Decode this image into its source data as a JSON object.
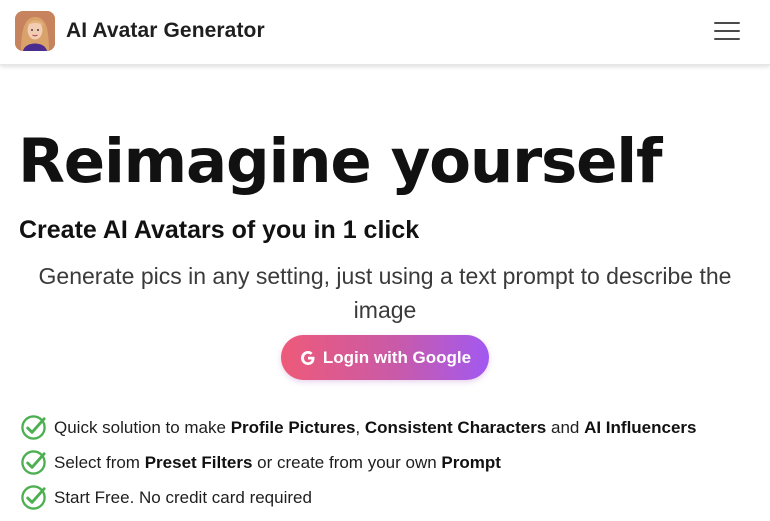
{
  "header": {
    "title": "AI Avatar Generator",
    "logo_icon": "avatar-photo-icon",
    "menu_icon": "hamburger-menu-icon"
  },
  "hero": {
    "title": "Reimagine yourself",
    "subtitle": "Create AI Avatars of you in 1 click",
    "description": "Generate pics in any setting, just using a text prompt to describe the image"
  },
  "cta": {
    "label": "Login with Google",
    "icon": "google-g-icon",
    "gradient": [
      "#ee5a79",
      "#a259f1"
    ]
  },
  "features": [
    {
      "parts": [
        {
          "text": "Quick solution to make ",
          "bold": false
        },
        {
          "text": "Profile Pictures",
          "bold": true
        },
        {
          "text": ", ",
          "bold": false
        },
        {
          "text": "Consistent Characters",
          "bold": true
        },
        {
          "text": " and ",
          "bold": false
        },
        {
          "text": "AI Influencers",
          "bold": true
        }
      ]
    },
    {
      "parts": [
        {
          "text": "Select from ",
          "bold": false
        },
        {
          "text": "Preset Filters",
          "bold": true
        },
        {
          "text": " or create from your own ",
          "bold": false
        },
        {
          "text": "Prompt",
          "bold": true
        }
      ]
    },
    {
      "parts": [
        {
          "text": "Start Free. No credit card required",
          "bold": false
        }
      ]
    }
  ],
  "colors": {
    "check_green": "#4caf50",
    "text": "#111111"
  }
}
